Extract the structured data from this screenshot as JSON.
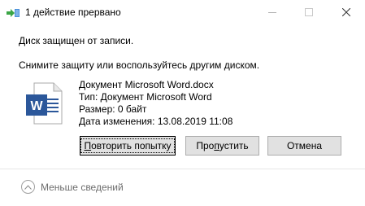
{
  "window": {
    "title": "1 действие прервано",
    "icon": "copy-progress-icon",
    "controls": {
      "minimize": "minimize-icon",
      "maximize": "maximize-icon",
      "close": "close-icon"
    }
  },
  "message": {
    "line1": "Диск защищен от записи.",
    "line2": "Снимите защиту или воспользуйтесь другим диском."
  },
  "file": {
    "icon": "word-document-icon",
    "name": "Документ Microsoft Word.docx",
    "type": "Тип: Документ Microsoft Word",
    "size": "Размер: 0 байт",
    "modified": "Дата изменения: 13.08.2019 11:08"
  },
  "buttons": {
    "retry": {
      "mnemonic": "П",
      "rest": "овторить попытку"
    },
    "skip": {
      "before": "Про",
      "mnemonic": "п",
      "after": "устить"
    },
    "cancel": "Отмена"
  },
  "footer": {
    "less_details": "Меньше сведений",
    "icon": "chevron-up-icon"
  },
  "colors": {
    "accent_blue": "#2b579a",
    "title_icon_green": "#3aa545",
    "button_bg": "#e1e1e1",
    "button_border": "#adadad"
  }
}
